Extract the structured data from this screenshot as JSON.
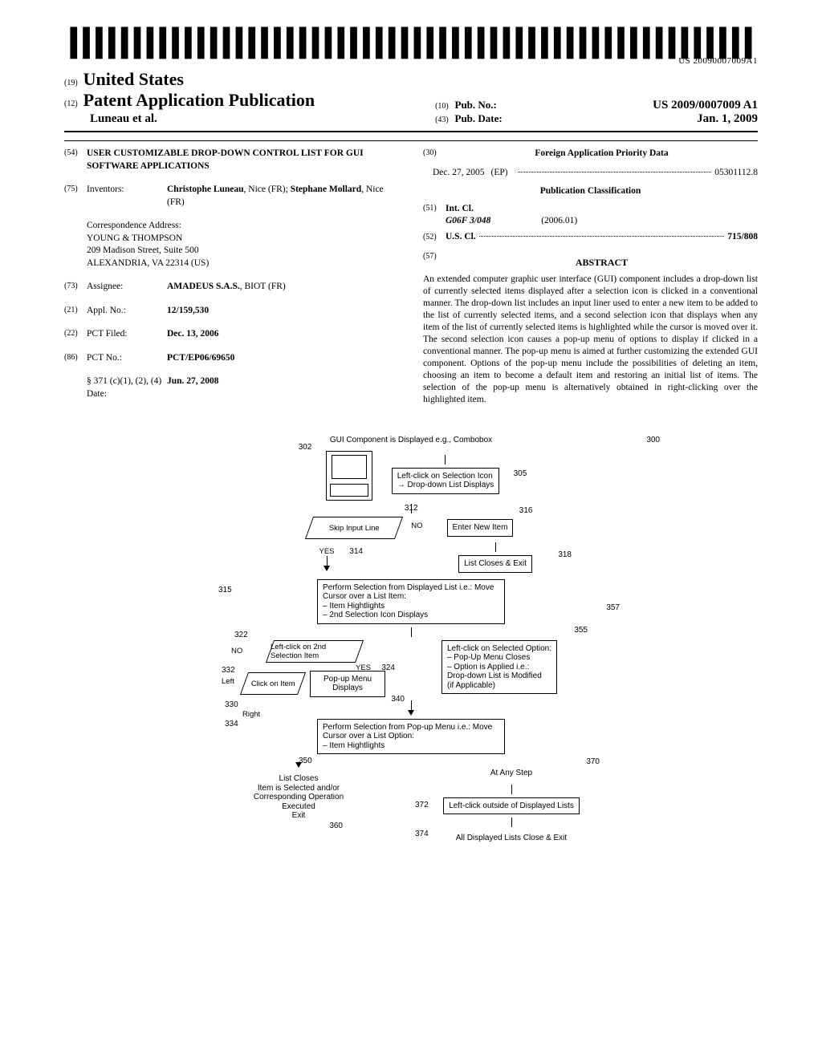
{
  "barcode_text": "US 20090007009A1",
  "header": {
    "num19": "(19)",
    "country": "United States",
    "num12": "(12)",
    "pub_type": "Patent Application Publication",
    "authors": "Luneau et al.",
    "num10": "(10)",
    "pub_no_label": "Pub. No.:",
    "pub_no": "US 2009/0007009 A1",
    "num43": "(43)",
    "pub_date_label": "Pub. Date:",
    "pub_date": "Jan. 1, 2009"
  },
  "left": {
    "f54_num": "(54)",
    "f54_title": "USER CUSTOMIZABLE DROP-DOWN CONTROL LIST FOR GUI SOFTWARE APPLICATIONS",
    "f75_num": "(75)",
    "f75_label": "Inventors:",
    "f75_value": "Christophe Luneau, Nice (FR); Stephane Mollard, Nice (FR)",
    "corr_label": "Correspondence Address:",
    "corr_1": "YOUNG & THOMPSON",
    "corr_2": "209 Madison Street, Suite 500",
    "corr_3": "ALEXANDRIA, VA 22314 (US)",
    "f73_num": "(73)",
    "f73_label": "Assignee:",
    "f73_value": "AMADEUS S.A.S., BIOT (FR)",
    "f21_num": "(21)",
    "f21_label": "Appl. No.:",
    "f21_value": "12/159,530",
    "f22_num": "(22)",
    "f22_label": "PCT Filed:",
    "f22_value": "Dec. 13, 2006",
    "f86_num": "(86)",
    "f86_label": "PCT No.:",
    "f86_value": "PCT/EP06/69650",
    "f371_label": "§ 371 (c)(1), (2), (4) Date:",
    "f371_value": "Jun. 27, 2008"
  },
  "right": {
    "f30_num": "(30)",
    "f30_heading": "Foreign Application Priority Data",
    "f30_date": "Dec. 27, 2005",
    "f30_country": "(EP)",
    "f30_app": "05301112.8",
    "class_heading": "Publication Classification",
    "f51_num": "(51)",
    "f51_label": "Int. Cl.",
    "f51_code": "G06F 3/048",
    "f51_year": "(2006.01)",
    "f52_num": "(52)",
    "f52_label": "U.S. Cl.",
    "f52_value": "715/808",
    "f57_num": "(57)",
    "abstract_heading": "ABSTRACT",
    "abstract_body": "An extended computer graphic user interface (GUI) component includes a drop-down list of currently selected items displayed after a selection icon is clicked in a conventional manner. The drop-down list includes an input liner used to enter a new item to be added to the list of currently selected items, and a second selection icon that displays when any item of the list of currently selected items is highlighted while the cursor is moved over it. The second selection icon causes a pop-up menu of options to display if clicked in a conventional manner. The pop-up menu is aimed at further customizing the extended GUI component. Options of the pop-up menu include the possibilities of deleting an item, choosing an item to become a default item and restoring an initial list of items. The selection of the pop-up menu is alternatively obtained in right-clicking over the highlighted item."
  },
  "diagram": {
    "title": "GUI Component is Displayed e.g., Combobox",
    "r300": "300",
    "r302": "302",
    "b305": "Left-click on Selection Icon\n→ Drop-down List Displays",
    "r305": "305",
    "d312": "Skip Input Line",
    "r312": "312",
    "no": "NO",
    "yes": "YES",
    "r314": "314",
    "b316": "Enter New Item",
    "r316": "316",
    "b318": "List Closes & Exit",
    "r318": "318",
    "b315": "Perform Selection from Displayed List i.e.: Move Cursor over a List Item:\n– Item Hightlights\n– 2nd Selection Icon Displays",
    "r315": "315",
    "d322": "Left-click on 2nd Selection Item",
    "r322": "322",
    "r324": "324",
    "d330": "Click on Item",
    "r330": "330",
    "r332": "332",
    "left_lbl": "Left",
    "right_lbl": "Right",
    "r334": "334",
    "b340": "Pop-up Menu Displays",
    "r340": "340",
    "b350": "Perform Selection from Pop-up Menu i.e.: Move Cursor over a List Option:\n– Item Hightlights",
    "r350": "350",
    "b355": "Left-click on Selected Option:\n– Pop-Up Menu Closes\n– Option is Applied i.e.:\n  Drop-down List is Modified\n  (if Applicable)",
    "r355": "355",
    "r357": "357",
    "b360": "List Closes\nItem is Selected and/or\nCorresponding Operation\nExecuted\nExit",
    "r360": "360",
    "b370": "At Any Step",
    "r370": "370",
    "b372": "Left-click outside of Displayed Lists",
    "r372": "372",
    "b374": "All Displayed Lists Close & Exit",
    "r374": "374"
  }
}
